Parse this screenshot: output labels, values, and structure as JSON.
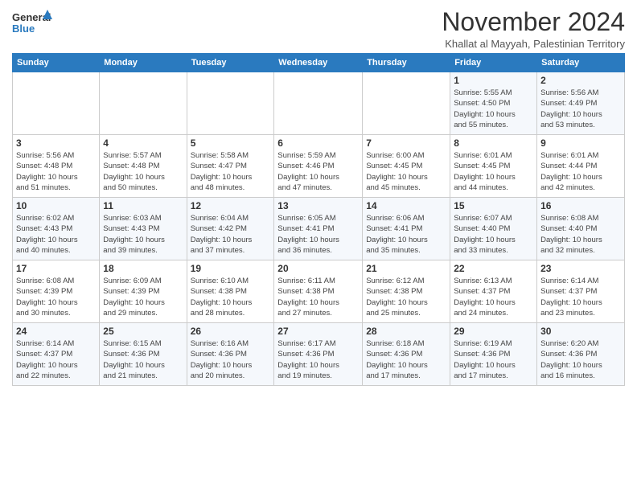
{
  "logo": {
    "line1": "General",
    "line2": "Blue"
  },
  "title": "November 2024",
  "subtitle": "Khallat al Mayyah, Palestinian Territory",
  "days_of_week": [
    "Sunday",
    "Monday",
    "Tuesday",
    "Wednesday",
    "Thursday",
    "Friday",
    "Saturday"
  ],
  "weeks": [
    [
      {
        "day": "",
        "info": ""
      },
      {
        "day": "",
        "info": ""
      },
      {
        "day": "",
        "info": ""
      },
      {
        "day": "",
        "info": ""
      },
      {
        "day": "",
        "info": ""
      },
      {
        "day": "1",
        "info": "Sunrise: 5:55 AM\nSunset: 4:50 PM\nDaylight: 10 hours\nand 55 minutes."
      },
      {
        "day": "2",
        "info": "Sunrise: 5:56 AM\nSunset: 4:49 PM\nDaylight: 10 hours\nand 53 minutes."
      }
    ],
    [
      {
        "day": "3",
        "info": "Sunrise: 5:56 AM\nSunset: 4:48 PM\nDaylight: 10 hours\nand 51 minutes."
      },
      {
        "day": "4",
        "info": "Sunrise: 5:57 AM\nSunset: 4:48 PM\nDaylight: 10 hours\nand 50 minutes."
      },
      {
        "day": "5",
        "info": "Sunrise: 5:58 AM\nSunset: 4:47 PM\nDaylight: 10 hours\nand 48 minutes."
      },
      {
        "day": "6",
        "info": "Sunrise: 5:59 AM\nSunset: 4:46 PM\nDaylight: 10 hours\nand 47 minutes."
      },
      {
        "day": "7",
        "info": "Sunrise: 6:00 AM\nSunset: 4:45 PM\nDaylight: 10 hours\nand 45 minutes."
      },
      {
        "day": "8",
        "info": "Sunrise: 6:01 AM\nSunset: 4:45 PM\nDaylight: 10 hours\nand 44 minutes."
      },
      {
        "day": "9",
        "info": "Sunrise: 6:01 AM\nSunset: 4:44 PM\nDaylight: 10 hours\nand 42 minutes."
      }
    ],
    [
      {
        "day": "10",
        "info": "Sunrise: 6:02 AM\nSunset: 4:43 PM\nDaylight: 10 hours\nand 40 minutes."
      },
      {
        "day": "11",
        "info": "Sunrise: 6:03 AM\nSunset: 4:43 PM\nDaylight: 10 hours\nand 39 minutes."
      },
      {
        "day": "12",
        "info": "Sunrise: 6:04 AM\nSunset: 4:42 PM\nDaylight: 10 hours\nand 37 minutes."
      },
      {
        "day": "13",
        "info": "Sunrise: 6:05 AM\nSunset: 4:41 PM\nDaylight: 10 hours\nand 36 minutes."
      },
      {
        "day": "14",
        "info": "Sunrise: 6:06 AM\nSunset: 4:41 PM\nDaylight: 10 hours\nand 35 minutes."
      },
      {
        "day": "15",
        "info": "Sunrise: 6:07 AM\nSunset: 4:40 PM\nDaylight: 10 hours\nand 33 minutes."
      },
      {
        "day": "16",
        "info": "Sunrise: 6:08 AM\nSunset: 4:40 PM\nDaylight: 10 hours\nand 32 minutes."
      }
    ],
    [
      {
        "day": "17",
        "info": "Sunrise: 6:08 AM\nSunset: 4:39 PM\nDaylight: 10 hours\nand 30 minutes."
      },
      {
        "day": "18",
        "info": "Sunrise: 6:09 AM\nSunset: 4:39 PM\nDaylight: 10 hours\nand 29 minutes."
      },
      {
        "day": "19",
        "info": "Sunrise: 6:10 AM\nSunset: 4:38 PM\nDaylight: 10 hours\nand 28 minutes."
      },
      {
        "day": "20",
        "info": "Sunrise: 6:11 AM\nSunset: 4:38 PM\nDaylight: 10 hours\nand 27 minutes."
      },
      {
        "day": "21",
        "info": "Sunrise: 6:12 AM\nSunset: 4:38 PM\nDaylight: 10 hours\nand 25 minutes."
      },
      {
        "day": "22",
        "info": "Sunrise: 6:13 AM\nSunset: 4:37 PM\nDaylight: 10 hours\nand 24 minutes."
      },
      {
        "day": "23",
        "info": "Sunrise: 6:14 AM\nSunset: 4:37 PM\nDaylight: 10 hours\nand 23 minutes."
      }
    ],
    [
      {
        "day": "24",
        "info": "Sunrise: 6:14 AM\nSunset: 4:37 PM\nDaylight: 10 hours\nand 22 minutes."
      },
      {
        "day": "25",
        "info": "Sunrise: 6:15 AM\nSunset: 4:36 PM\nDaylight: 10 hours\nand 21 minutes."
      },
      {
        "day": "26",
        "info": "Sunrise: 6:16 AM\nSunset: 4:36 PM\nDaylight: 10 hours\nand 20 minutes."
      },
      {
        "day": "27",
        "info": "Sunrise: 6:17 AM\nSunset: 4:36 PM\nDaylight: 10 hours\nand 19 minutes."
      },
      {
        "day": "28",
        "info": "Sunrise: 6:18 AM\nSunset: 4:36 PM\nDaylight: 10 hours\nand 17 minutes."
      },
      {
        "day": "29",
        "info": "Sunrise: 6:19 AM\nSunset: 4:36 PM\nDaylight: 10 hours\nand 17 minutes."
      },
      {
        "day": "30",
        "info": "Sunrise: 6:20 AM\nSunset: 4:36 PM\nDaylight: 10 hours\nand 16 minutes."
      }
    ]
  ]
}
